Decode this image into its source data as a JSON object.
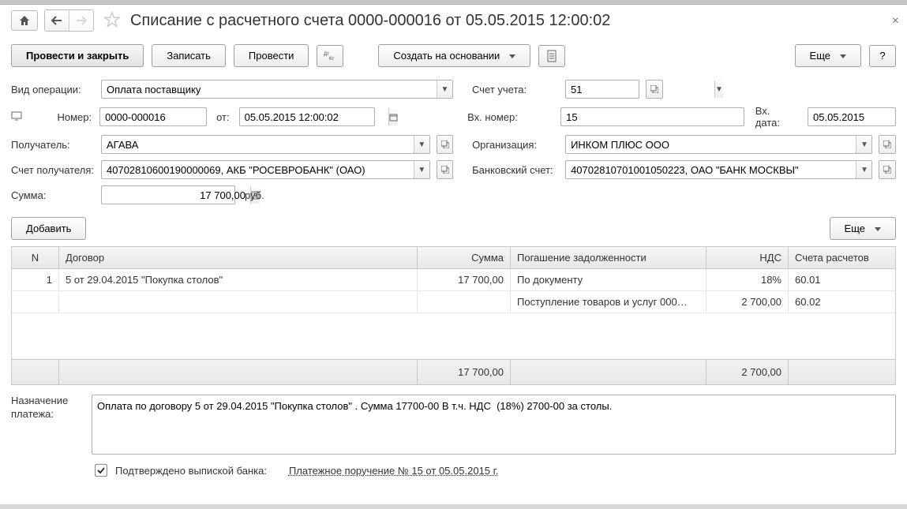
{
  "title": "Списание с расчетного счета 0000-000016 от 05.05.2015 12:00:02",
  "toolbar": {
    "post_close": "Провести и закрыть",
    "save": "Записать",
    "post": "Провести",
    "create_based": "Создать на основании",
    "more": "Еще"
  },
  "labels": {
    "op_type": "Вид операции:",
    "account": "Счет учета:",
    "number": "Номер:",
    "from": "от:",
    "in_number": "Вх. номер:",
    "in_date": "Вх. дата:",
    "recipient": "Получатель:",
    "organization": "Организация:",
    "recipient_account": "Счет получателя:",
    "bank_account": "Банковский счет:",
    "sum": "Сумма:",
    "currency": "руб.",
    "add": "Добавить",
    "purpose": "Назначение платежа:",
    "confirmed": "Подтверждено выпиской банка:"
  },
  "values": {
    "op_type": "Оплата поставщику",
    "account": "51",
    "number": "0000-000016",
    "date": "05.05.2015 12:00:02",
    "in_number": "15",
    "in_date": "05.05.2015",
    "recipient": "АГАВА",
    "organization": "ИНКОМ ПЛЮС ООО",
    "recipient_account": "40702810600190000069, АКБ \"РОСЕВРОБАНК\" (ОАО)",
    "bank_account": "40702810701001050223, ОАО \"БАНК МОСКВЫ\"",
    "sum": "17 700,00",
    "purpose": "Оплата по договору 5 от 29.04.2015 \"Покупка столов\" . Сумма 17700-00 В т.ч. НДС  (18%) 2700-00 за столы.",
    "order_link": "Платежное поручение № 15 от 05.05.2015 г."
  },
  "grid": {
    "headers": {
      "n": "N",
      "contract": "Договор",
      "sum": "Сумма",
      "debt": "Погашение задолженности",
      "vat": "НДС",
      "accounts": "Счета расчетов"
    },
    "row1": {
      "n": "1",
      "contract": "5 от 29.04.2015 \"Покупка столов\"",
      "sum": "17 700,00",
      "debt": "По документу",
      "vat": "18%",
      "acc": "60.01"
    },
    "row2": {
      "debt": "Поступление товаров и услуг 000…",
      "vat": "2 700,00",
      "acc": "60.02"
    },
    "footer": {
      "sum": "17 700,00",
      "vat": "2 700,00"
    }
  }
}
